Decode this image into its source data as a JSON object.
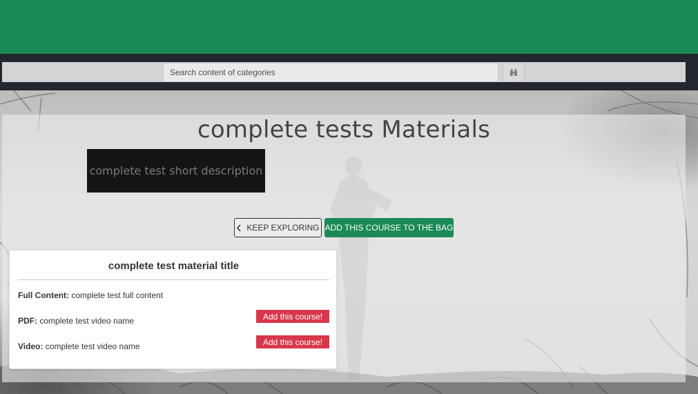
{
  "search": {
    "placeholder": "Search content of categories",
    "button_icon": "binoculars-icon"
  },
  "page": {
    "title": "complete tests Materials",
    "short_description": "complete test short description"
  },
  "actions": {
    "keep_exploring": "KEEP EXPLORING",
    "add_to_bag": "ADD THIS COURSE TO THE BAG"
  },
  "material": {
    "title": "complete test material title",
    "rows": [
      {
        "label": "Full Content:",
        "value": "complete test full content"
      },
      {
        "label": "PDF:",
        "value": "complete test video name",
        "button": "Add this course!"
      },
      {
        "label": "Video:",
        "value": "complete test video name",
        "button": "Add this course!"
      }
    ]
  },
  "colors": {
    "brand_green": "#1b8a56",
    "dark_strip": "#23262d",
    "danger_red": "#d9374b"
  }
}
